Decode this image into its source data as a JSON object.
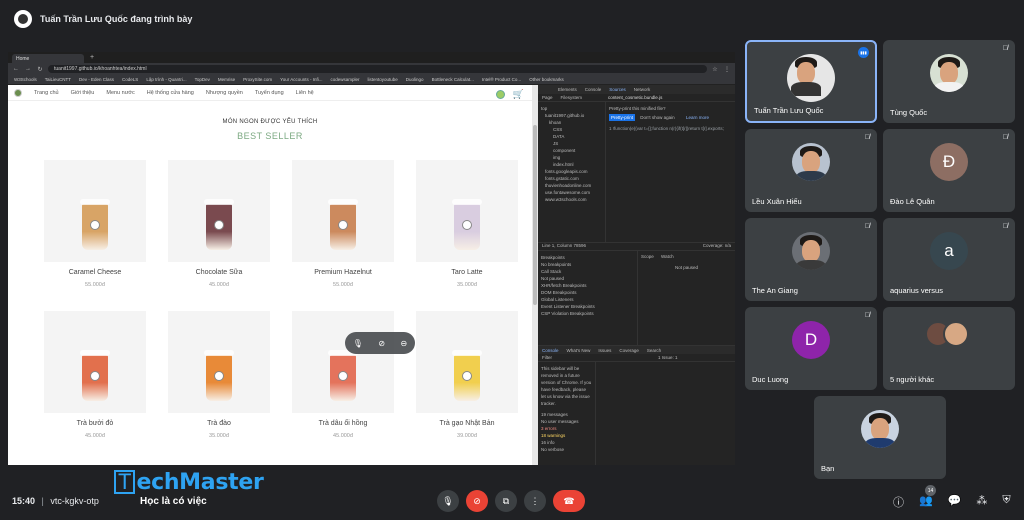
{
  "presenting": {
    "text": "Tuấn Trần Lưu Quốc đang trình bày"
  },
  "browser": {
    "tab_title": "Home",
    "url": "tuanit1997.github.io/khoanhtea/index.html",
    "bookmarks": [
      "W3Schools",
      "TaiLieuCNTT",
      "Dev - Eden Class",
      "CodeLS",
      "Lập trình - Quantri...",
      "TopDev",
      "Memrise",
      "ProxySite.com",
      "Your Accounts - Infi...",
      "codewsampler",
      "listentoyoutube",
      "Duolingo",
      "Bottleneck Calculat...",
      "Intel® Product Co...",
      "Other bookmarks"
    ]
  },
  "site": {
    "nav": [
      "Trang chủ",
      "Giới thiệu",
      "Menu nước",
      "Hệ thống cửa hàng",
      "Nhượng quyền",
      "Tuyển dụng",
      "Liên hệ"
    ],
    "menu_subtitle": "MÓN NGON ĐƯỢC YÊU THÍCH",
    "menu_title": "BEST SELLER",
    "products": [
      {
        "name": "Caramel Cheese",
        "price": "55.000đ",
        "color": "#d8a466"
      },
      {
        "name": "Chocolate Sữa",
        "price": "45.000đ",
        "color": "#7a4a4f"
      },
      {
        "name": "Premium Hazelnut",
        "price": "55.000đ",
        "color": "#cc8a5e"
      },
      {
        "name": "Taro Latte",
        "price": "35.000đ",
        "color": "#d9cde0"
      },
      {
        "name": "Trà bưởi đỏ",
        "price": "45.000đ",
        "color": "#e2704d"
      },
      {
        "name": "Trà đào",
        "price": "35.000đ",
        "color": "#e88a38"
      },
      {
        "name": "Trà dâu ổi hồng",
        "price": "45.000đ",
        "color": "#e4735c"
      },
      {
        "name": "Trà gạo Nhật Bản",
        "price": "39.000đ",
        "color": "#f1cf4e"
      }
    ]
  },
  "devtools": {
    "tabs": [
      "Elements",
      "Console",
      "Sources",
      "Network"
    ],
    "active_tab": "Sources",
    "sub_tabs": [
      "Page",
      "Filesystem"
    ],
    "file_tab": "content_cosmetic.bundle.js",
    "pretty_print": "Pretty-print this minified file?",
    "pretty_btn": "Pretty-print",
    "dont_show": "Don't show again",
    "learn_more": "Learn more",
    "tree": [
      "top",
      "tuanit1997.github.io",
      "khoan",
      "CSS",
      "DATA",
      "JS",
      "component",
      "img",
      "index.html",
      "fonts.googleapis.com",
      "fonts.gstatic.com",
      "thuvienhoadonline.com",
      "use.fontawesome.com",
      "www.w3schools.com"
    ],
    "line_info": "Line 1, Column 78596",
    "coverage": "Coverage: n/a",
    "scope_tabs": [
      "Scope",
      "Watch"
    ],
    "not_paused": "Not paused",
    "breakpoints": [
      "Breakpoints",
      "No breakpoints",
      "Call Stack",
      "Not paused",
      "XHR/fetch Breakpoints",
      "DOM Breakpoints",
      "Global Listeners",
      "Event Listener Breakpoints",
      "CSP Violation Breakpoints"
    ],
    "console_tabs": [
      "Console",
      "What's New",
      "Issues",
      "Coverage",
      "Search"
    ],
    "console_filter": "Filter",
    "console_issue": "1 Issue: 1",
    "console_msg": "This sidebar will be removed in a future version of Chrome. If you have feedback, please let us know via the issue tracker.",
    "console_left": [
      "19 messages",
      "No user messages",
      "3 errors",
      "18 warnings",
      "16 info",
      "No verbose"
    ]
  },
  "participants": [
    {
      "name": "Tuấn Trần Lưu Quốc",
      "kind": "photo",
      "speaking": true
    },
    {
      "name": "Tùng Quốc",
      "kind": "photo",
      "muted": true
    },
    {
      "name": "Lều Xuân Hiếu",
      "kind": "photo",
      "muted": true
    },
    {
      "name": "Đào Lê Quân",
      "kind": "letter",
      "letter": "Đ",
      "color": "#8d6e63",
      "muted": true
    },
    {
      "name": "The An Giang",
      "kind": "photo",
      "muted": true
    },
    {
      "name": "aquarius versus",
      "kind": "letter",
      "letter": "a",
      "color": "#37474f",
      "muted": true
    },
    {
      "name": "Duc Luong",
      "kind": "letter",
      "letter": "D",
      "color": "#8e24aa",
      "muted": true
    },
    {
      "name": "5 người khác",
      "kind": "group"
    },
    {
      "name": "Bạn",
      "kind": "photo"
    }
  ],
  "bottom": {
    "time": "15:40",
    "code": "vtc-kgkv-otp",
    "brand": "echMaster",
    "brand_t": "T",
    "slogan": "Học là có việc",
    "people_count": "14"
  }
}
